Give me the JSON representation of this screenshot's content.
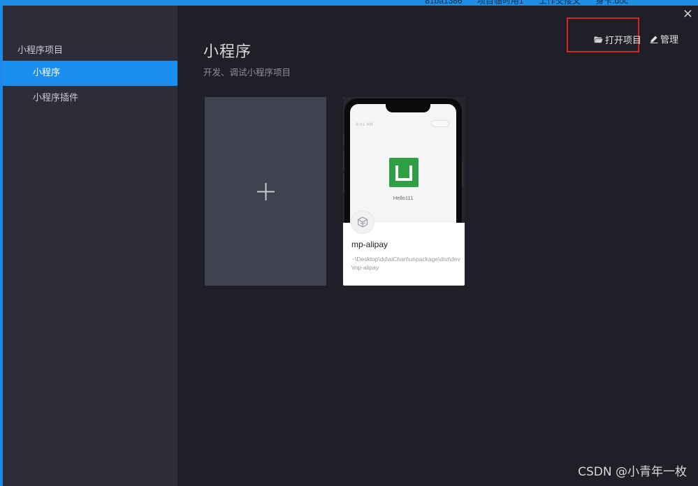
{
  "desktop": {
    "crumbs": [
      "81ba1386",
      "项目临时用1",
      "工作交接文",
      "身卡.doc"
    ]
  },
  "sidebar": {
    "heading": "小程序项目",
    "items": [
      {
        "label": "小程序",
        "active": true
      },
      {
        "label": "小程序插件",
        "active": false
      }
    ]
  },
  "header": {
    "title": "小程序",
    "subtitle": "开发、调试小程序项目"
  },
  "toolbar": {
    "open_label": "打开项目",
    "manage_label": "管理",
    "close_glyph": "×"
  },
  "new_project": {
    "icon": "plus-icon"
  },
  "projects": [
    {
      "name": "mp-alipay",
      "path": "~\\Desktop\\dd\\aiChart\\unpackage\\dist\\dev\\mp-alipay",
      "preview_text": "Hello111",
      "preview_status": "9:41 AM",
      "logo_color": "#2ea043"
    }
  ],
  "colors": {
    "accent": "#1a8ff0",
    "highlight": "#e0241c"
  },
  "watermark": "CSDN @小青年一枚"
}
